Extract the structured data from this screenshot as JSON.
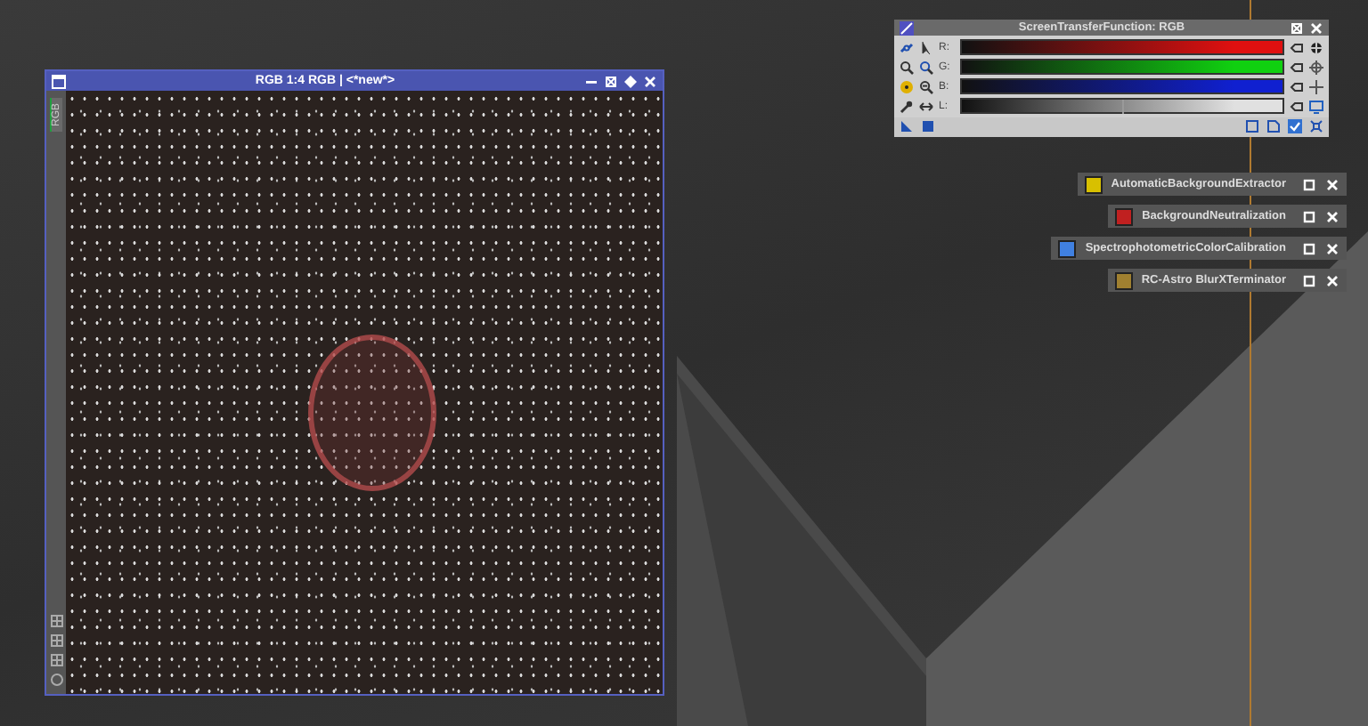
{
  "image_window": {
    "title": "RGB 1:4 RGB | <*new*>",
    "side_tab": "RGB"
  },
  "stf_panel": {
    "title": "ScreenTransferFunction: RGB",
    "channels": [
      {
        "label": "R:",
        "color": "#e01010"
      },
      {
        "label": "G:",
        "color": "#10d010"
      },
      {
        "label": "B:",
        "color": "#1020d0"
      },
      {
        "label": "L:",
        "color": "#e0e0e0",
        "level": 0.5
      }
    ]
  },
  "process_icons": [
    {
      "label": "AutomaticBackgroundExtractor",
      "color": "#d8c000"
    },
    {
      "label": "BackgroundNeutralization",
      "color": "#c02020"
    },
    {
      "label": "SpectrophotometricColorCalibration",
      "color": "#4080e0"
    },
    {
      "label": "RC-Astro BlurXTerminator",
      "color": "#a08030"
    }
  ]
}
